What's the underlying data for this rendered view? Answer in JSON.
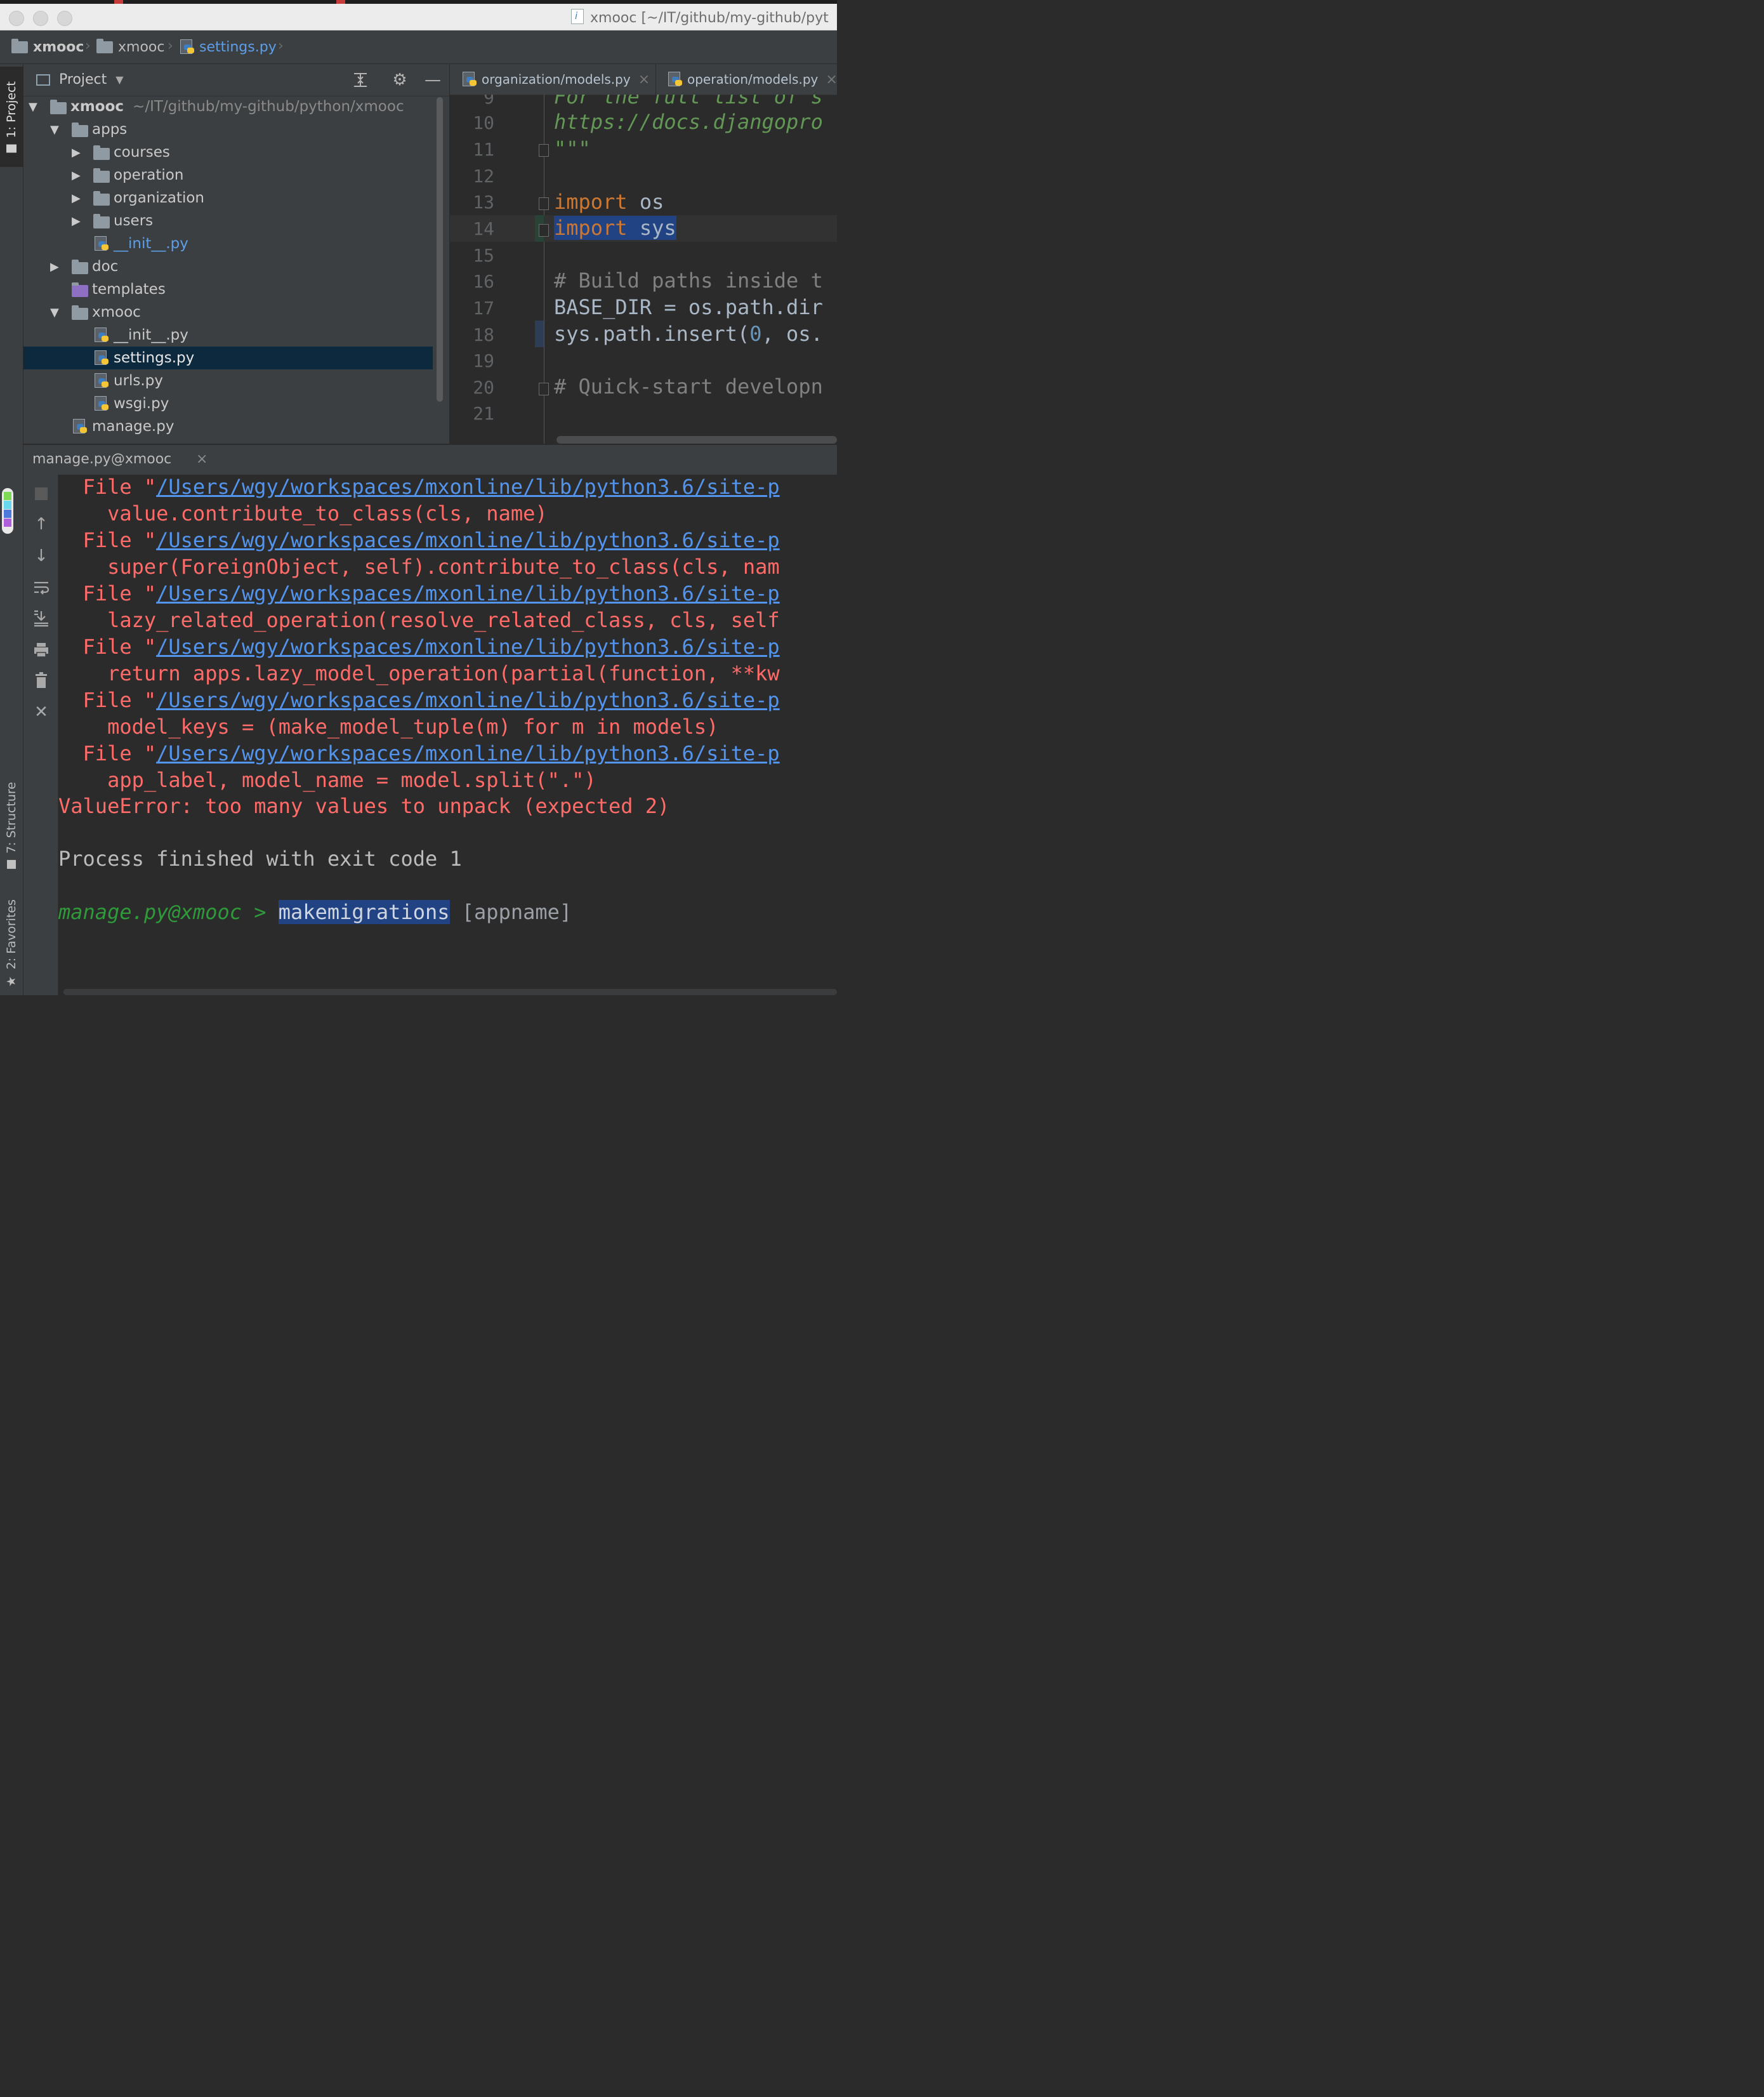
{
  "window": {
    "title": "xmooc [~/IT/github/my-github/pyt"
  },
  "breadcrumb": {
    "items": [
      "xmooc",
      "xmooc",
      "settings.py"
    ]
  },
  "left_strip": {
    "project_tab": "1: Project",
    "structure_tab": "7: Structure",
    "favorites_tab": "2: Favorites"
  },
  "project": {
    "title": "Project",
    "root": {
      "name": "xmooc",
      "path": "~/IT/github/my-github/python/xmooc"
    },
    "tree": [
      {
        "label": "apps"
      },
      {
        "label": "courses"
      },
      {
        "label": "operation"
      },
      {
        "label": "organization"
      },
      {
        "label": "users"
      },
      {
        "label": "__init__.py"
      },
      {
        "label": "doc"
      },
      {
        "label": "templates"
      },
      {
        "label": "xmooc"
      },
      {
        "label": "__init__.py"
      },
      {
        "label": "settings.py"
      },
      {
        "label": "urls.py"
      },
      {
        "label": "wsgi.py"
      },
      {
        "label": "manage.py"
      }
    ]
  },
  "editor": {
    "tabs": [
      "organization/models.py",
      "operation/models.py"
    ],
    "line_numbers": [
      "9",
      "10",
      "11",
      "12",
      "13",
      "14",
      "15",
      "16",
      "17",
      "18",
      "19",
      "20",
      "21"
    ],
    "lines": {
      "l9": "For the full list of s",
      "l10": "https://docs.djangopro",
      "l11": "\"\"\"",
      "l13_kw": "import",
      "l13_rest": " os",
      "l14_kw": "import",
      "l14_rest": " sys",
      "l16": "# Build paths inside t",
      "l17": "BASE_DIR = os.path.dir",
      "l18_a": "sys.path.insert(",
      "l18_num": "0",
      "l18_b": ", os.",
      "l20": "# Quick-start developn"
    }
  },
  "run": {
    "tab_label": "manage.py@xmooc",
    "traceback": [
      {
        "file_prefix": "File \"",
        "link": "/Users/wgy/workspaces/mxonline/lib/python3.6/site-p",
        "code": "  value.contribute_to_class(cls, name)"
      },
      {
        "file_prefix": "File \"",
        "link": "/Users/wgy/workspaces/mxonline/lib/python3.6/site-p",
        "code": "  super(ForeignObject, self).contribute_to_class(cls, nam"
      },
      {
        "file_prefix": "File \"",
        "link": "/Users/wgy/workspaces/mxonline/lib/python3.6/site-p",
        "code": "  lazy_related_operation(resolve_related_class, cls, self"
      },
      {
        "file_prefix": "File \"",
        "link": "/Users/wgy/workspaces/mxonline/lib/python3.6/site-p",
        "code": "  return apps.lazy_model_operation(partial(function, **kw"
      },
      {
        "file_prefix": "File \"",
        "link": "/Users/wgy/workspaces/mxonline/lib/python3.6/site-p",
        "code": "  model_keys = (make_model_tuple(m) for m in models)"
      },
      {
        "file_prefix": "File \"",
        "link": "/Users/wgy/workspaces/mxonline/lib/python3.6/site-p",
        "code": "  app_label, model_name = model.split(\".\")"
      }
    ],
    "error": "ValueError: too many values to unpack (expected 2)",
    "exit_message": "Process finished with exit code 1",
    "prompt": "manage.py@xmooc > ",
    "command": "makemigrations",
    "command_hint": " [appname]"
  }
}
